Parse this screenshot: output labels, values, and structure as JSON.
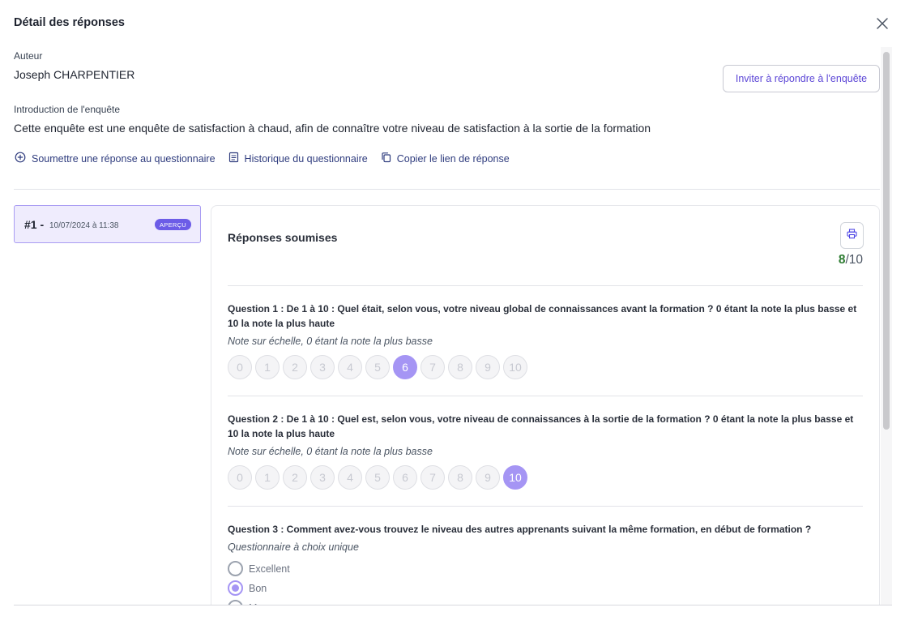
{
  "modal": {
    "title": "Détail des réponses"
  },
  "author": {
    "label": "Auteur",
    "name": "Joseph CHARPENTIER"
  },
  "invite_button": {
    "label": "Inviter à répondre à l'enquête"
  },
  "intro": {
    "label": "Introduction de l'enquête",
    "text": "Cette enquête est une enquête de satisfaction à chaud, afin de connaître votre niveau de satisfaction à la sortie de la formation"
  },
  "actions": {
    "submit": "Soumettre une réponse au questionnaire",
    "history": "Historique du questionnaire",
    "copy_link": "Copier le lien de réponse"
  },
  "responses": [
    {
      "number": "#1 -",
      "date": "10/07/2024 à 11:38",
      "badge": "APERÇU"
    }
  ],
  "panel": {
    "title": "Réponses soumises",
    "score_obtained": "8",
    "score_total": "/10"
  },
  "questions": [
    {
      "title": "Question 1 : De 1 à 10 : Quel était, selon vous, votre niveau global de connaissances avant la formation ? 0 étant la note la plus basse et 10 la note la plus haute",
      "subtitle": "Note sur échelle, 0 étant la note la plus basse",
      "scale": [
        "0",
        "1",
        "2",
        "3",
        "4",
        "5",
        "6",
        "7",
        "8",
        "9",
        "10"
      ],
      "selected": "6"
    },
    {
      "title": "Question 2 : De 1 à 10 : Quel est, selon vous, votre niveau de connaissances à la sortie de la formation ? 0 étant la note la plus basse et 10 la note la plus haute",
      "subtitle": "Note sur échelle, 0 étant la note la plus basse",
      "scale": [
        "0",
        "1",
        "2",
        "3",
        "4",
        "5",
        "6",
        "7",
        "8",
        "9",
        "10"
      ],
      "selected": "10"
    },
    {
      "title": "Question 3 : Comment avez-vous trouvez le niveau des autres apprenants suivant la même formation, en début de formation ?",
      "subtitle": "Questionnaire à choix unique",
      "options": [
        "Excellent",
        "Bon",
        "Moyen"
      ],
      "selected": "Bon"
    }
  ],
  "colors": {
    "accent": "#6c5ce7",
    "selected_fill": "#a595f4",
    "link": "#2f3c7e",
    "score_green": "#2e7d32"
  }
}
